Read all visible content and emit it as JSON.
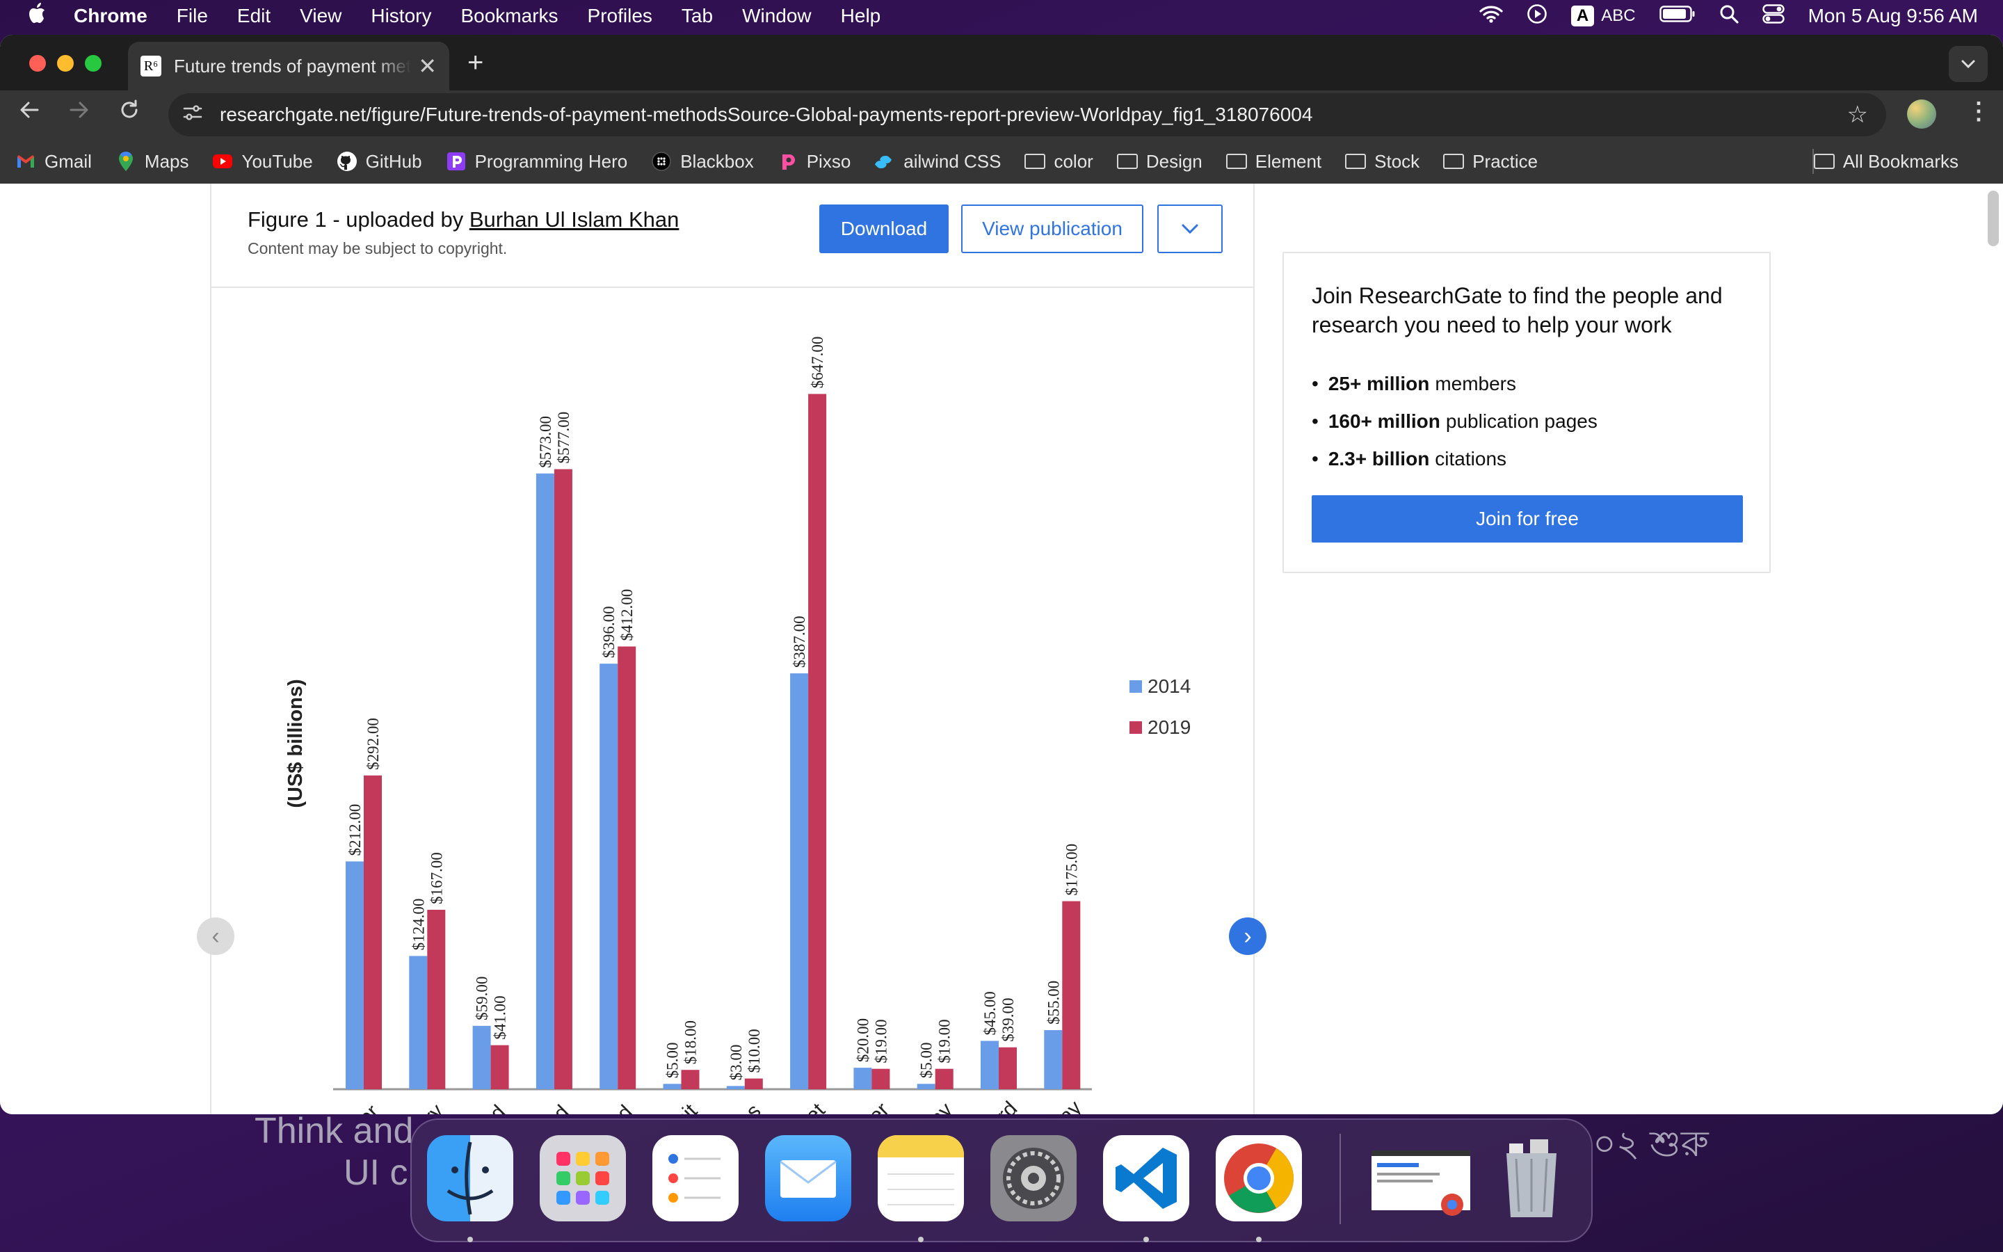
{
  "menubar": {
    "app": "Chrome",
    "items": [
      "File",
      "Edit",
      "View",
      "History",
      "Bookmarks",
      "Profiles",
      "Tab",
      "Window",
      "Help"
    ],
    "input_source": "ABC",
    "input_badge": "A",
    "clock": "Mon 5 Aug  9:56 AM"
  },
  "tab": {
    "title": "Future trends of payment methodsSource-Global-payments-report",
    "favicon": "R⁶"
  },
  "omnibox": {
    "url": "researchgate.net/figure/Future-trends-of-payment-methodsSource-Global-payments-report-preview-Worldpay_fig1_318076004"
  },
  "bookmarks": {
    "items": [
      {
        "label": "Gmail",
        "icon": "gmail-icon"
      },
      {
        "label": "Maps",
        "icon": "maps-icon"
      },
      {
        "label": "YouTube",
        "icon": "youtube-icon"
      },
      {
        "label": "GitHub",
        "icon": "github-icon"
      },
      {
        "label": "Programming Hero",
        "icon": "programming-hero-icon"
      },
      {
        "label": "Blackbox",
        "icon": "blackbox-icon"
      },
      {
        "label": "Pixso",
        "icon": "pixso-icon"
      },
      {
        "label": "ailwind CSS",
        "icon": "tailwind-icon"
      }
    ],
    "folders": [
      "color",
      "Design",
      "Element",
      "Stock",
      "Practice"
    ],
    "all": "All Bookmarks"
  },
  "figure": {
    "title_prefix": "Figure 1 - uploaded by ",
    "uploader": "Burhan Ul Islam Khan",
    "subtitle": "Content may be subject to copyright.",
    "download": "Download",
    "view_publication": "View publication"
  },
  "join": {
    "title": "Join ResearchGate to find the people and research you need to help your work",
    "stats": [
      {
        "bold": "25+ million",
        "text": "members"
      },
      {
        "bold": "160+ million",
        "text": "publication pages"
      },
      {
        "bold": "2.3+ billion",
        "text": "citations"
      }
    ],
    "button": "Join for free"
  },
  "wallpaper": {
    "line1": "Think and",
    "line2": "UI c",
    "right": "০২ শুরু"
  },
  "colors": {
    "accent": "#2f74e0",
    "series2014": "#6a9de8",
    "series2019": "#c2395a"
  },
  "chart_data": {
    "type": "bar",
    "ylabel": "(US$ billions)",
    "categories": [
      "nsfer",
      "livery",
      "Card",
      "Card",
      "Card",
      "Debit",
      "oices",
      "Vallet",
      "Other",
      "stPay",
      "l Card",
      "cePay"
    ],
    "series": [
      {
        "name": "2014",
        "values": [
          212,
          124,
          59,
          573,
          396,
          5,
          3,
          387,
          20,
          5,
          45,
          55
        ]
      },
      {
        "name": "2019",
        "values": [
          292,
          167,
          41,
          577,
          412,
          18,
          10,
          647,
          19,
          19,
          39,
          175
        ]
      }
    ],
    "labels2014": [
      "$212.00",
      "$124.00",
      "$59.00",
      "$573.00",
      "$396.00",
      "$5.00",
      "$3.00",
      "$387.00",
      "$20.00",
      "$5.00",
      "$45.00",
      "$55.00"
    ],
    "labels2019": [
      "$292.00",
      "$167.00",
      "$41.00",
      "$577.00",
      "$412.00",
      "$18.00",
      "$10.00",
      "$647.00",
      "$19.00",
      "$19.00",
      "$39.00",
      "$175.00"
    ],
    "ylim": [
      0,
      700
    ],
    "legend_position": "right"
  }
}
